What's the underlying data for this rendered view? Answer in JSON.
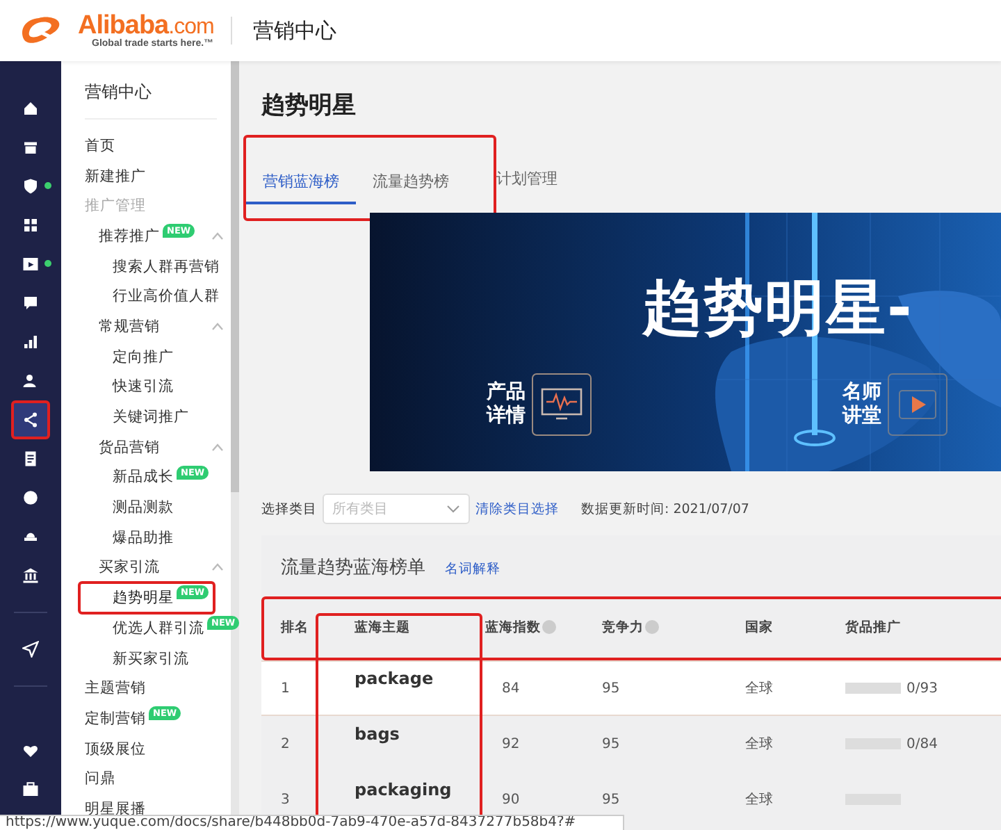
{
  "header": {
    "logo": "Alibaba",
    "logo_suffix": ".com",
    "logo_tagline": "Global trade starts here.™",
    "title": "营销中心"
  },
  "nav": [
    {
      "selected": false,
      "dot": false
    },
    {
      "selected": false,
      "dot": false
    },
    {
      "selected": false,
      "dot": true
    },
    {
      "selected": false,
      "dot": false
    },
    {
      "selected": false,
      "dot": true
    },
    {
      "selected": false,
      "dot": false
    },
    {
      "selected": false,
      "dot": false
    },
    {
      "selected": false,
      "dot": false
    },
    {
      "selected": true,
      "dot": false
    },
    {
      "selected": false,
      "dot": false
    },
    {
      "selected": false,
      "dot": false
    },
    {
      "selected": false,
      "dot": false
    },
    {
      "selected": false,
      "dot": false
    },
    {
      "selected": false,
      "dot": false
    },
    {
      "selected": false,
      "dot": false
    },
    {
      "selected": false,
      "dot": false
    }
  ],
  "sidebar": {
    "title": "营销中心",
    "items": [
      {
        "kind": "link",
        "label": "首页"
      },
      {
        "kind": "link",
        "label": "新建推广"
      },
      {
        "kind": "heading",
        "label": "推广管理"
      },
      {
        "kind": "section",
        "label": "推荐推广",
        "new": "NEW",
        "expanded": true,
        "children": [
          {
            "label": "搜索人群再营销",
            "selected": false
          },
          {
            "label": "行业高价值人群",
            "selected": false
          }
        ]
      },
      {
        "kind": "section",
        "label": "常规营销",
        "new": false,
        "expanded": true,
        "children": [
          {
            "label": "定向推广",
            "selected": false
          },
          {
            "label": "快速引流",
            "selected": false
          },
          {
            "label": "关键词推广",
            "selected": false
          }
        ]
      },
      {
        "kind": "section",
        "label": "货品营销",
        "new": false,
        "expanded": true,
        "children": [
          {
            "label": "新品成长",
            "selected": false,
            "new": "NEW"
          },
          {
            "label": "测品测款",
            "selected": false
          },
          {
            "label": "爆品助推",
            "selected": false
          }
        ]
      },
      {
        "kind": "section",
        "label": "买家引流",
        "new": false,
        "expanded": true,
        "children": [
          {
            "label": "趋势明星",
            "selected": true,
            "new": "NEW",
            "highlighted": true
          },
          {
            "label": "优选人群引流",
            "selected": false,
            "new": "NEW",
            "highlighted": false
          },
          {
            "label": "新买家引流",
            "selected": false
          }
        ]
      },
      {
        "kind": "link",
        "label": "主题营销"
      },
      {
        "kind": "link",
        "label": "定制营销",
        "new": "NEW"
      },
      {
        "kind": "link",
        "label": "顶级展位"
      },
      {
        "kind": "link",
        "label": "问鼎"
      },
      {
        "kind": "link",
        "label": "明星展播"
      }
    ]
  },
  "page_title": "趋势明星",
  "tabs": [
    {
      "label": "营销蓝海榜",
      "selected": true,
      "highlighted": true
    },
    {
      "label": "流量趋势榜",
      "selected": false,
      "highlighted": true
    },
    {
      "label": "计划管理",
      "selected": false,
      "highlighted": false
    }
  ],
  "banner": {
    "headline": "趋势明星-",
    "item_1": [
      "产品",
      "详情"
    ],
    "item_2": [
      "名师",
      "讲堂"
    ]
  },
  "filter": {
    "label": "选择类目",
    "select_placeholder": "所有类目",
    "clear_link": "清除类目选择",
    "updated": "数据更新时间: 2021/07/07"
  },
  "table": {
    "title": "流量趋势蓝海榜单",
    "help_link": "名词解释",
    "header_highlighted": true,
    "topic_column_highlighted": true,
    "columns": [
      {
        "label": "排名",
        "help": false
      },
      {
        "label": "蓝海主题",
        "help": false
      },
      {
        "label": "蓝海指数",
        "help": true
      },
      {
        "label": "竞争力",
        "help": true
      },
      {
        "label": "国家",
        "help": false
      },
      {
        "label": "货品推广",
        "help": false
      }
    ],
    "rows": [
      {
        "rank": "1",
        "topic": "package",
        "index": "84",
        "competition": "95",
        "country": "全球",
        "level": 0,
        "promo": "0/93",
        "hovered": true
      },
      {
        "rank": "2",
        "topic": "bags",
        "index": "92",
        "competition": "95",
        "country": "全球",
        "level": 0,
        "promo": "0/84",
        "hovered": false
      },
      {
        "rank": "3",
        "topic": "packaging",
        "index": "90",
        "competition": "95",
        "country": "全球",
        "level": 0,
        "hovered": false
      }
    ]
  },
  "status_url": "https://www.yuque.com/docs/share/b448bb0d-7ab9-470e-a57d-8437277b58b4?#"
}
